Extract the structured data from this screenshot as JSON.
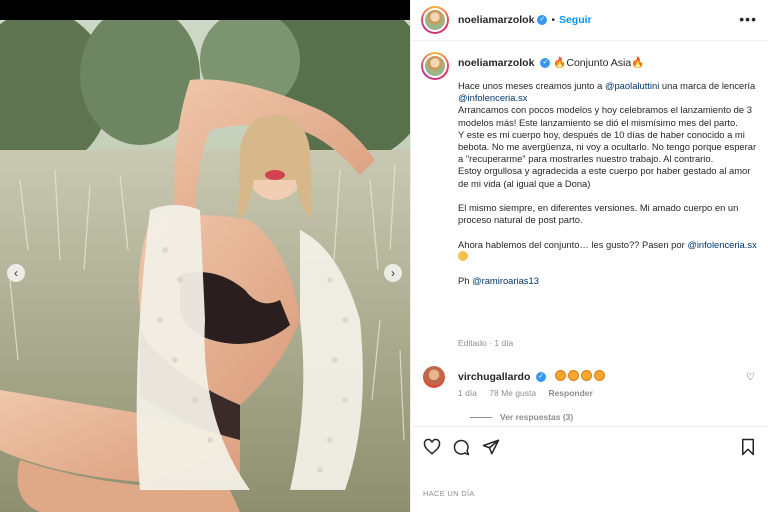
{
  "account": {
    "username": "noeliamarzolok",
    "follow_label": "Seguir",
    "dot": "•"
  },
  "caption": {
    "title": "Conjunto Asia",
    "lines": {
      "l1_a": "Hace unos meses creamos junto a ",
      "l1_mention": "@paolaluttini",
      "l1_b": " una marca de lencería ",
      "l1_mention2": "@infolenceria.sx",
      "l2": "Arrancamos con pocos modelos y hoy celebramos el lanzamiento de 3 modelos más! Este lanzamiento se dió el mismísimo mes del parto.",
      "l3": "Y este es mi cuerpo hoy, después de 10 días de haber conocido a mi bebota. No me avergüenza, ni voy a ocultarlo. No tengo porque esperar a \"recuperarme\" para mostrarles nuestro trabajo. Al contrario.",
      "l4": "Estoy orgullosa y agradecida a este cuerpo por haber gestado al amor de mi vida (al igual que a Dona)",
      "l5": "El mismo siempre, en diferentes versiones. Mi amado cuerpo en un proceso natural de post parto.",
      "l6_a": "Ahora hablemos del conjunto… les gusto?? Pasen por ",
      "l6_mention": "@infolenceria.sx",
      "l7_a": "Ph ",
      "l7_mention": "@ramiroarias13"
    },
    "edited": "Editado · 1 día"
  },
  "comment": {
    "username": "virchugallardo",
    "time": "1 día",
    "likes": "78 Me gusta",
    "reply_label": "Responder",
    "view_replies": "Ver respuestas (3)"
  },
  "timestamp": "HACE UN DÍA",
  "icons": {
    "prev": "‹",
    "next": "›",
    "more": "•••",
    "heart": "♡",
    "check": "✓"
  },
  "colors": {
    "link": "#0095f6",
    "mention": "#00376b",
    "muted": "#8e8e8e",
    "verified": "#3897f0"
  }
}
